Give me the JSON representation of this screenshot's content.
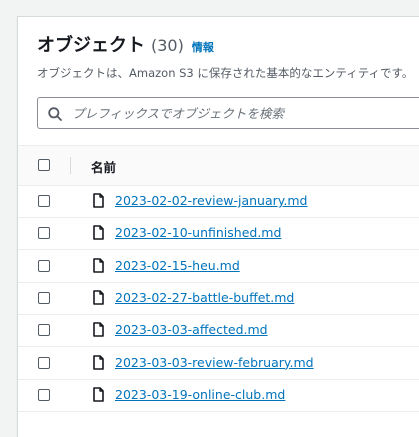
{
  "header": {
    "title": "オブジェクト",
    "count": "(30)",
    "info_link": "情報",
    "description": "オブジェクトは、Amazon S3 に保存された基本的なエンティティです。"
  },
  "search": {
    "placeholder": "プレフィックスでオブジェクトを検索",
    "value": "",
    "icon": "search-icon"
  },
  "table": {
    "columns": [
      "名前"
    ],
    "rows": [
      {
        "name": "2023-02-02-review-january.md",
        "icon": "file-icon"
      },
      {
        "name": "2023-02-10-unfinished.md",
        "icon": "file-icon"
      },
      {
        "name": "2023-02-15-heu.md",
        "icon": "file-icon"
      },
      {
        "name": "2023-02-27-battle-buffet.md",
        "icon": "file-icon"
      },
      {
        "name": "2023-03-03-affected.md",
        "icon": "file-icon"
      },
      {
        "name": "2023-03-03-review-february.md",
        "icon": "file-icon"
      },
      {
        "name": "2023-03-19-online-club.md",
        "icon": "file-icon"
      }
    ]
  },
  "colors": {
    "link": "#0073bb",
    "text": "#16191f",
    "muted": "#545b64",
    "border": "#eaeded"
  }
}
